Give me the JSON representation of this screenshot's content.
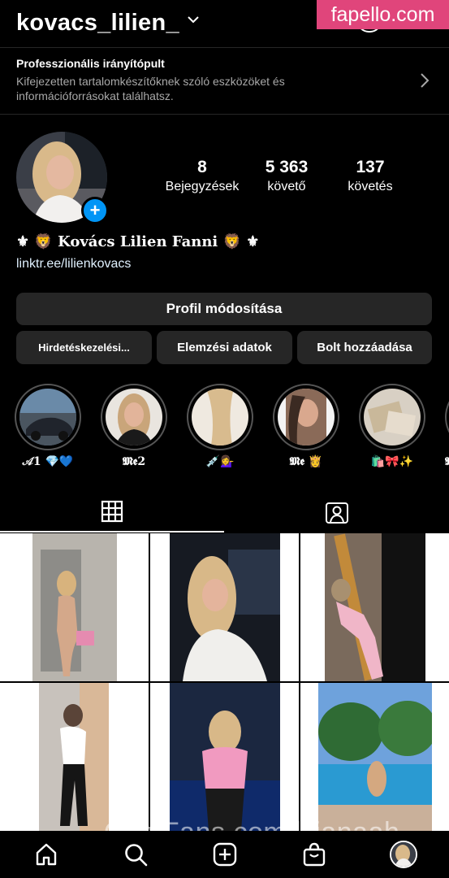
{
  "header": {
    "username": "kovacs_lilien_",
    "watermark": "fapello.com"
  },
  "dashboard": {
    "title": "Professzionális irányítópult",
    "subtitle": "Kifejezetten tartalomkészítőknek szóló eszközöket és információforrásokat találhatsz."
  },
  "profile": {
    "stats": [
      {
        "value": "8",
        "label": "Bejegyzések"
      },
      {
        "value": "5 363",
        "label": "követő"
      },
      {
        "value": "137",
        "label": "követés"
      }
    ],
    "bio_name": "⚜️🦁𝕂𝕠𝕧á𝕔𝕤 𝕃𝕚𝕝𝕚𝕖𝕟 𝔽𝕒𝕟𝕟𝕚🦁⚜️",
    "bio_name_plain": "⚜ 🦁 Kovács Lilien Fanni 🦁 ⚜",
    "link": "linktr.ee/lilienkovacs"
  },
  "buttons": {
    "edit_profile": "Profil módosítása",
    "ads": "Hirdetéskezelési...",
    "insights": "Elemzési adatok",
    "shop": "Bolt hozzáadása"
  },
  "highlights": [
    {
      "label": "𝒜1 💎💙"
    },
    {
      "label": "𝕸𝖊2"
    },
    {
      "label": "💉💁‍♀️"
    },
    {
      "label": "𝕸𝖊 👸"
    },
    {
      "label": "🛍️🎀✨"
    },
    {
      "label": "𝕸"
    }
  ],
  "tabs": [
    {
      "name": "grid-icon"
    },
    {
      "name": "tagged-icon"
    }
  ],
  "nav": [
    "home-icon",
    "search-icon",
    "add-icon",
    "shop-icon",
    "profile-avatar"
  ],
  "watermark_bottom": "OnlyFans.com/lilianaah",
  "colors": {
    "background": "#000000",
    "button": "#262626",
    "accent": "#0095f6",
    "watermark": "#e0457b"
  }
}
